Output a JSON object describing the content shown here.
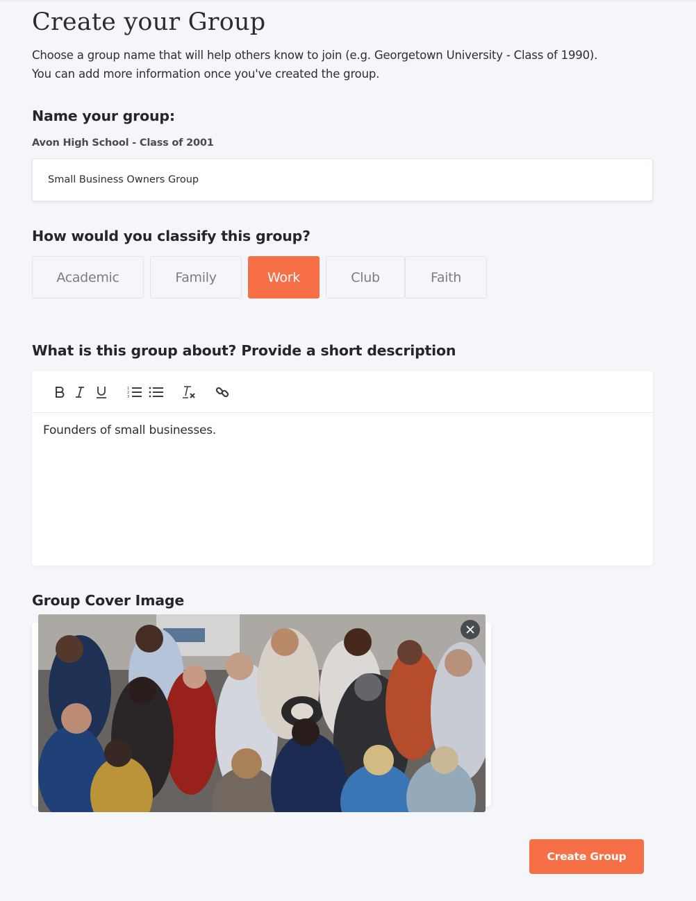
{
  "page": {
    "title": "Create your Group",
    "subtitle_line1": "Choose a group name that will help others know to join (e.g. Georgetown University - Class of 1990).",
    "subtitle_line2": "You can add more information once you've created the group."
  },
  "name_section": {
    "label": "Name your group:",
    "hint": "Avon High School - Class of 2001",
    "value": "Small Business Owners Group"
  },
  "classify_section": {
    "label": "How would you classify this group?",
    "options": [
      {
        "label": "Academic",
        "selected": false
      },
      {
        "label": "Family",
        "selected": false
      },
      {
        "label": "Work",
        "selected": true
      },
      {
        "label": "Club",
        "selected": false
      },
      {
        "label": "Faith",
        "selected": false
      }
    ],
    "accent_color": "#f76f47"
  },
  "description_section": {
    "label": "What is this group about? Provide a short description",
    "toolbar": [
      "bold-icon",
      "italic-icon",
      "underline-icon",
      "ordered-list-icon",
      "bullet-list-icon",
      "clear-format-icon",
      "link-icon"
    ],
    "value": "Founders of small businesses."
  },
  "cover_section": {
    "label": "Group Cover Image",
    "image_alt": "Crowd of people networking at a business event",
    "remove_icon": "close-icon"
  },
  "actions": {
    "create_label": "Create Group"
  }
}
